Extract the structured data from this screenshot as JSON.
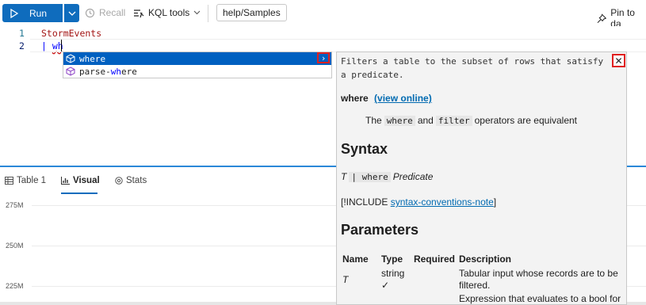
{
  "toolbar": {
    "run_label": "Run",
    "recall_label": "Recall",
    "kql_tools_label": "KQL tools",
    "database": "help/Samples",
    "pin_label": "Pin to da"
  },
  "editor": {
    "line_numbers": [
      "1",
      "2"
    ],
    "line1": "StormEvents",
    "line2_pipe": "| ",
    "line2_typed": "wh"
  },
  "suggestions": [
    {
      "label": "where",
      "icon": "cube-icon"
    },
    {
      "prefix": "parse-",
      "match": "wh",
      "suffix": "ere",
      "icon": "cube-icon"
    }
  ],
  "docs": {
    "summary": "Filters a table to the subset of rows that satisfy a predicate.",
    "name": "where",
    "view_online": "(view online)",
    "note_pre": "The",
    "note_where": "where",
    "note_and": "and",
    "note_filter": "filter",
    "note_post": "operators are equivalent",
    "syntax_heading": "Syntax",
    "syntax_T": "T",
    "syntax_op": "| where",
    "syntax_predicate": "Predicate",
    "include_pre": "[!INCLUDE ",
    "include_link": "syntax-conventions-note",
    "include_post": "]",
    "params_heading": "Parameters",
    "params_columns": [
      "Name",
      "Type",
      "Required",
      "Description"
    ],
    "params_rows": [
      {
        "name": "T",
        "type": "string",
        "required": "✓",
        "description": "Tabular input whose records are to be filtered."
      },
      {
        "name": "",
        "type": "",
        "required": "",
        "description": "Expression that evaluates to a bool for"
      }
    ]
  },
  "results_tabs": [
    {
      "label": "Table 1",
      "icon": "table-icon"
    },
    {
      "label": "Visual",
      "icon": "chart-icon"
    },
    {
      "label": "Stats",
      "icon": "stats-icon"
    }
  ],
  "chart_axis": {
    "y_ticks": [
      "275M",
      "250M",
      "225M"
    ]
  },
  "colors": {
    "accent": "#0f6cbd",
    "selection": "#0060c0",
    "highlight_box": "#e02020"
  }
}
